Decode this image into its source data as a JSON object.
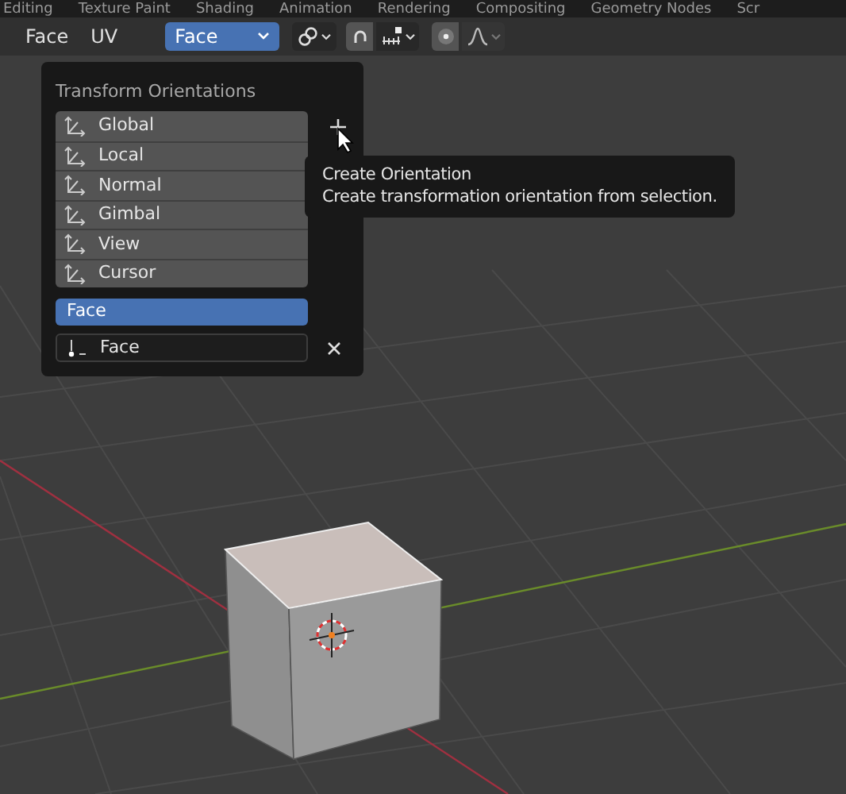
{
  "workspace_tabs": [
    "Editing",
    "Texture Paint",
    "Shading",
    "Animation",
    "Rendering",
    "Compositing",
    "Geometry Nodes",
    "Scr"
  ],
  "header": {
    "menus": [
      "Face",
      "UV"
    ],
    "orientation_dropdown": {
      "value": "Face"
    }
  },
  "orientations_popup": {
    "title": "Transform Orientations",
    "options": [
      {
        "label": "Global",
        "selected": false
      },
      {
        "label": "Local",
        "selected": false
      },
      {
        "label": "Normal",
        "selected": false
      },
      {
        "label": "Gimbal",
        "selected": false
      },
      {
        "label": "View",
        "selected": false
      },
      {
        "label": "Cursor",
        "selected": false
      }
    ],
    "custom": [
      {
        "label": "Face",
        "selected": true
      }
    ],
    "name_field": {
      "value": "Face"
    }
  },
  "tooltip": {
    "title": "Create Orientation",
    "description": "Create transformation orientation from selection."
  }
}
